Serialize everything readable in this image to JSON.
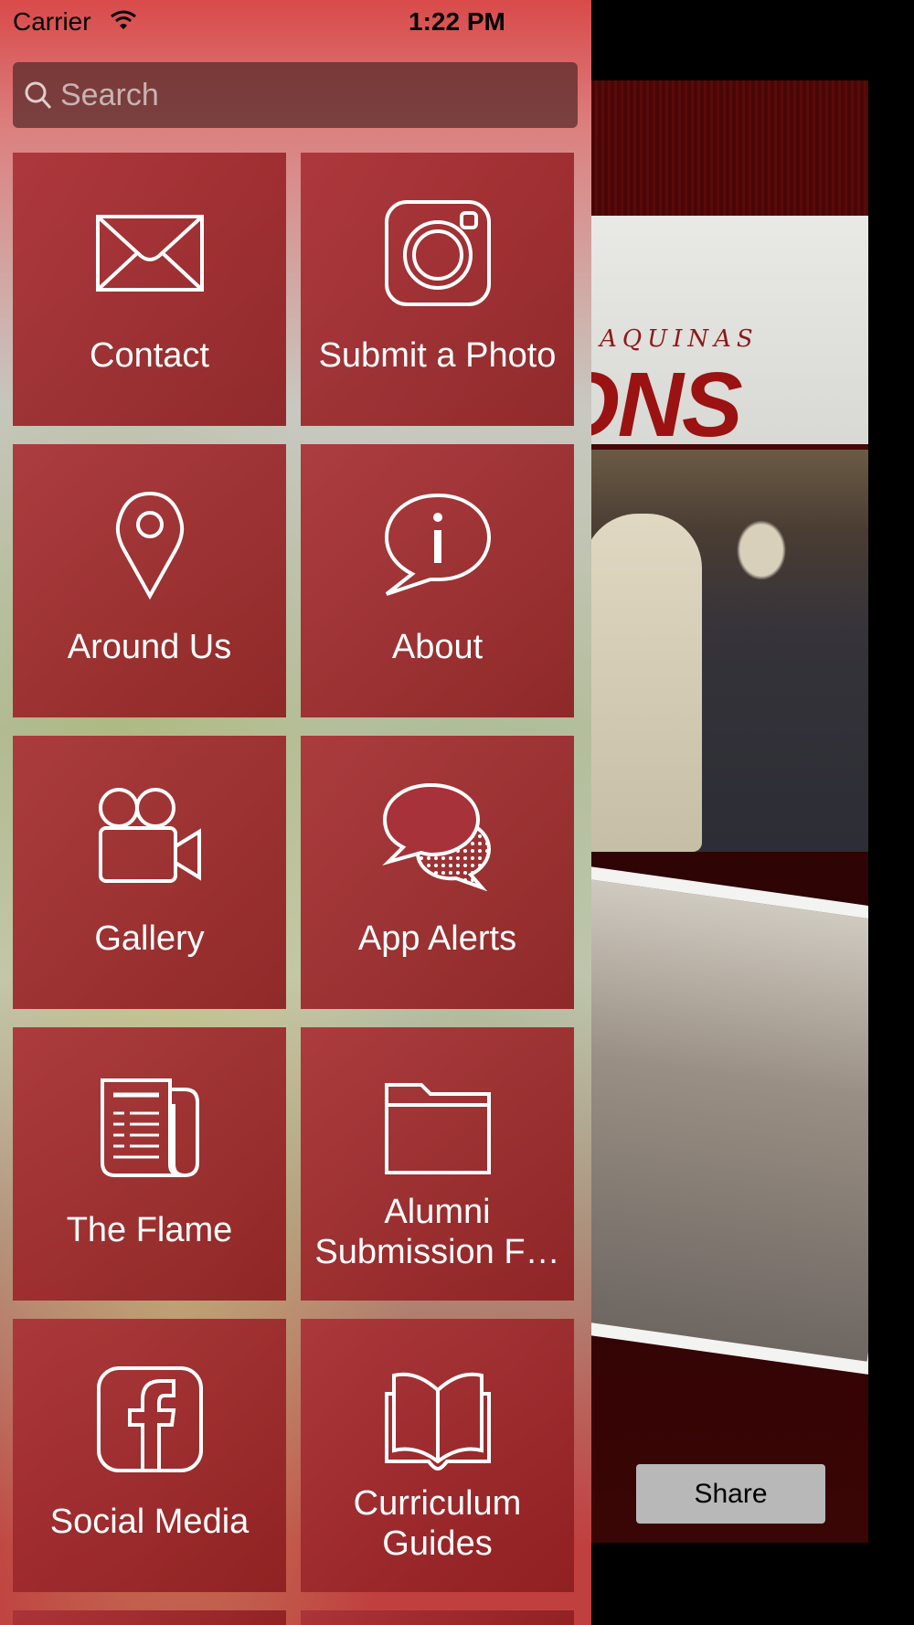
{
  "status_bar": {
    "carrier": "Carrier",
    "time": "1:22 PM"
  },
  "search": {
    "placeholder": "Search"
  },
  "menu": {
    "tiles": [
      {
        "label": "Contact",
        "icon": "envelope-icon"
      },
      {
        "label": "Submit a Photo",
        "icon": "camera-icon"
      },
      {
        "label": "Around Us",
        "icon": "map-pin-icon"
      },
      {
        "label": "About",
        "icon": "info-bubble-icon"
      },
      {
        "label": "Gallery",
        "icon": "video-camera-icon"
      },
      {
        "label": "App Alerts",
        "icon": "chat-bubbles-icon"
      },
      {
        "label": "The Flame",
        "icon": "newspaper-icon"
      },
      {
        "label": "Alumni\nSubmission F…",
        "icon": "folder-icon"
      },
      {
        "label": "Social Media",
        "icon": "facebook-icon"
      },
      {
        "label": "Curriculum\nGuides",
        "icon": "open-book-icon"
      }
    ]
  },
  "background": {
    "banner_small": "S AQUINAS",
    "banner_big": "ONS",
    "share_label": "Share"
  },
  "colors": {
    "tile": "#a8323a",
    "accent": "#9a1212",
    "share_button": "#b8b8b8"
  }
}
